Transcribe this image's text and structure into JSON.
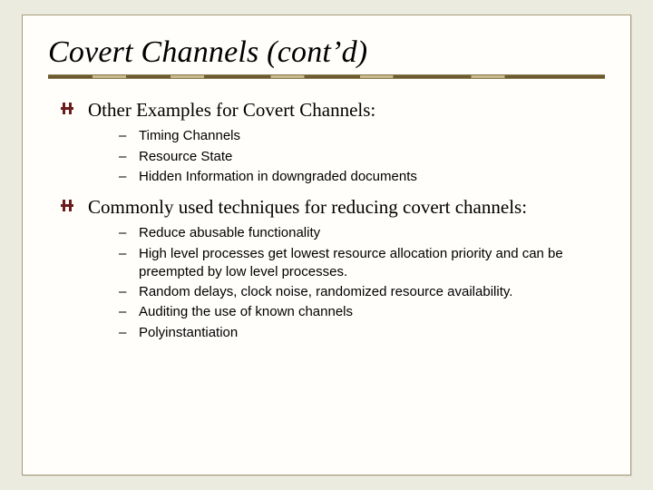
{
  "title": "Covert Channels (cont’d)",
  "sections": [
    {
      "heading": "Other Examples for Covert Channels:",
      "items": [
        "Timing Channels",
        "Resource State",
        "Hidden Information in downgraded documents"
      ]
    },
    {
      "heading": "Commonly used techniques for reducing covert channels:",
      "items": [
        "Reduce abusable functionality",
        "High level processes get lowest resource allocation priority and can be preempted by low level processes.",
        "Random delays, clock noise, randomized resource availability.",
        "Auditing the use of known channels",
        "Polyinstantiation"
      ]
    }
  ]
}
